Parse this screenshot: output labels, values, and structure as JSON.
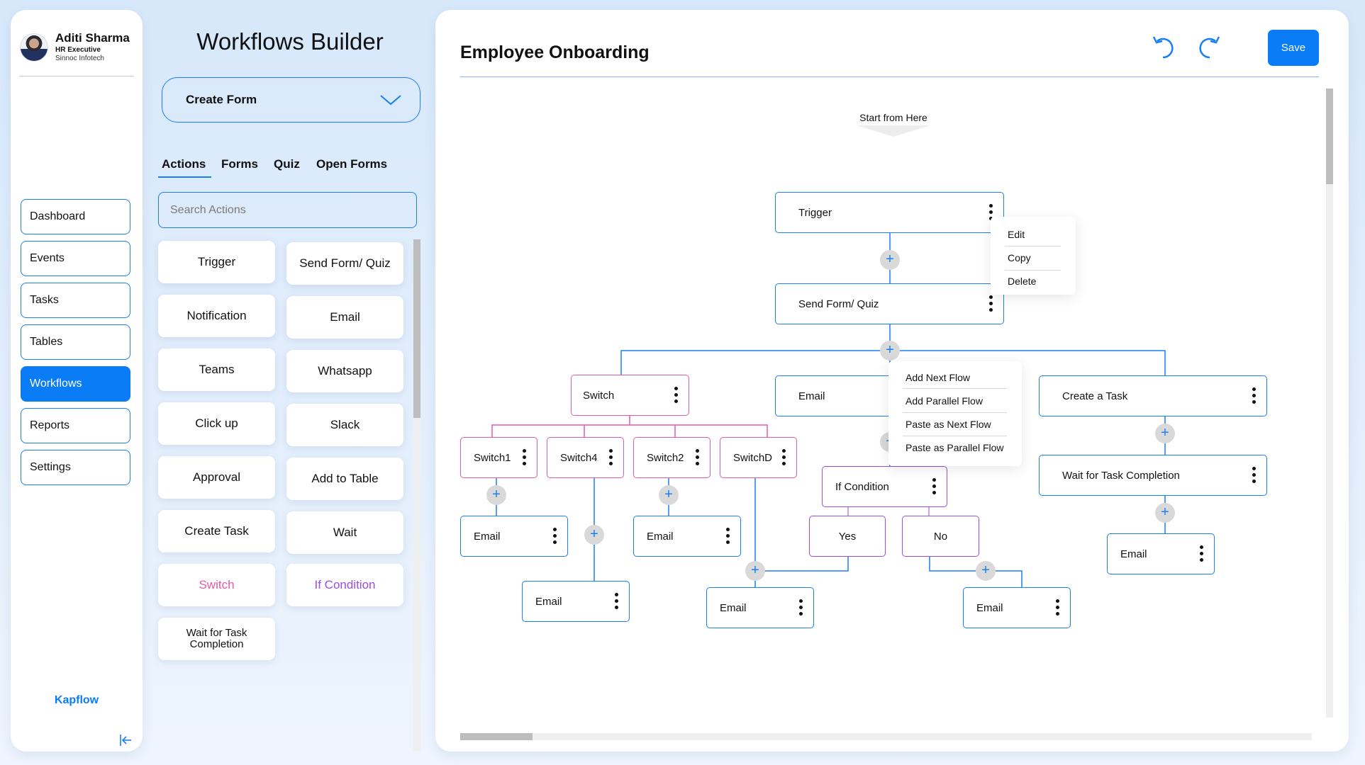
{
  "user": {
    "name": "Aditi Sharma",
    "role": "HR Executive",
    "organization": "Sinnoc Infotech"
  },
  "sidebar": {
    "items": [
      {
        "label": "Dashboard",
        "active": false
      },
      {
        "label": "Events",
        "active": false
      },
      {
        "label": "Tasks",
        "active": false
      },
      {
        "label": "Tables",
        "active": false
      },
      {
        "label": "Workflows",
        "active": true
      },
      {
        "label": "Reports",
        "active": false
      },
      {
        "label": "Settings",
        "active": false
      }
    ],
    "brand": "Kapflow",
    "collapse_icon": "collapse-left-icon"
  },
  "builder": {
    "title": "Workflows Builder",
    "create_form": {
      "selected": "Create Form",
      "icon": "chevron-down-icon"
    },
    "tabs": [
      {
        "label": "Actions",
        "active": true
      },
      {
        "label": "Forms",
        "active": false
      },
      {
        "label": "Quiz",
        "active": false
      },
      {
        "label": "Open Forms",
        "active": false
      }
    ],
    "search": {
      "placeholder": "Search Actions",
      "value": ""
    },
    "actions": [
      "Trigger",
      "Send Form/ Quiz",
      "Notification",
      "Email",
      "Teams",
      "Whatsapp",
      "Click up",
      "Slack",
      "Approval",
      "Add to Table",
      "Create Task",
      "Wait",
      "Switch",
      "If Condition",
      "Wait for Task Completion"
    ]
  },
  "canvas": {
    "title": "Employee Onboarding",
    "undo_icon": "undo-icon",
    "redo_icon": "redo-icon",
    "save_label": "Save",
    "start_label": "Start from Here",
    "nodes": {
      "trigger": "Trigger",
      "send_form": "Send Form/ Quiz",
      "switch": "Switch",
      "email_mid": "Email",
      "create_task": "Create a Task",
      "wait_task": "Wait for Task Completion",
      "switch1": "Switch1",
      "switch4": "Switch4",
      "switch2": "Switch2",
      "switchD": "SwitchD",
      "email_s1": "Email",
      "email_s4": "Email",
      "email_s2": "Email",
      "email_sD": "Email",
      "if_condition": "If Condition",
      "yes": "Yes",
      "no": "No",
      "email_no": "Email",
      "email_task": "Email"
    },
    "node_menu": [
      "Edit",
      "Copy",
      "Delete"
    ],
    "add_menu": [
      "Add Next Flow",
      "Add Parallel Flow",
      "Paste as Next Flow",
      "Paste as Parallel Flow"
    ],
    "colors": {
      "accent": "#0a7cf5",
      "switch": "#e55aa6",
      "condition": "#9a4ee0"
    }
  }
}
